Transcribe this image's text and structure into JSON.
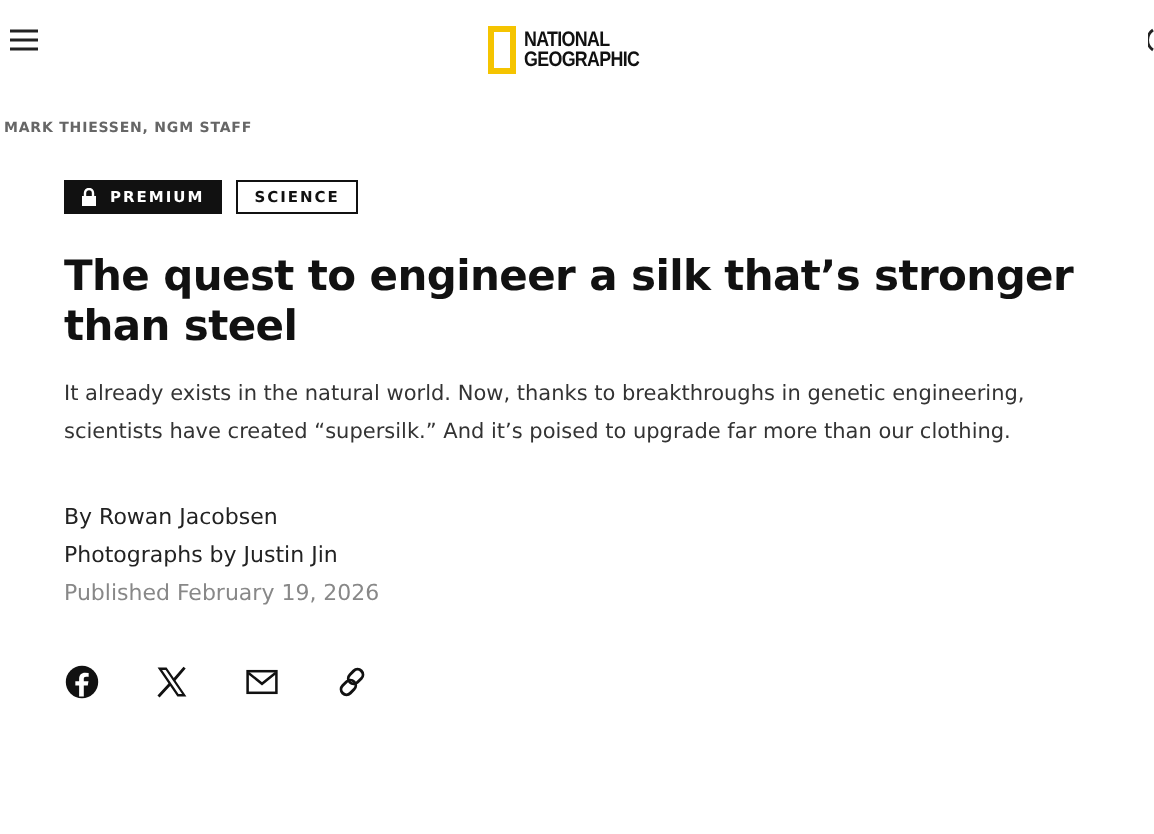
{
  "header": {
    "logo_lines": [
      "NATIONAL",
      "GEOGRAPHIC"
    ]
  },
  "photo_credit": "MARK THIESSEN, NGM STAFF",
  "tags": [
    {
      "label": "PREMIUM",
      "kind": "premium"
    },
    {
      "label": "SCIENCE",
      "kind": "section"
    }
  ],
  "headline": "The quest to engineer a silk that’s stronger than steel",
  "dek": "It already exists in the natural world. Now, thanks to breakthroughs in genetic engineering, scientists have created “supersilk.” And it’s poised to upgrade far more than our clothing.",
  "byline": "By Rowan Jacobsen",
  "photographer": "Photographs by Justin Jin",
  "published": "Published February 19, 2026",
  "share": [
    {
      "kind": "facebook"
    },
    {
      "kind": "x"
    },
    {
      "kind": "email"
    },
    {
      "kind": "link"
    }
  ]
}
